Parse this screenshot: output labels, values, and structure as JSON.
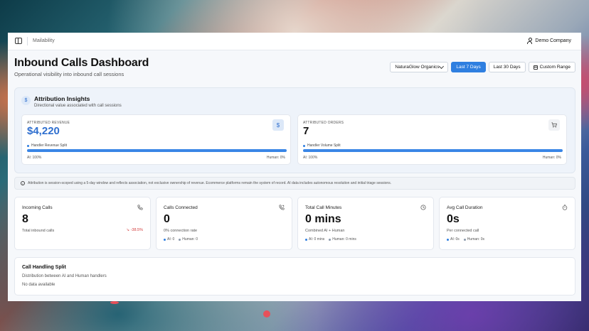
{
  "topbar": {
    "breadcrumb": "Mailability",
    "company": "Demo Company"
  },
  "header": {
    "title": "Inbound Calls Dashboard",
    "subtitle": "Operational visibility into inbound call sessions"
  },
  "controls": {
    "store_select": "NaturaGlow Organics",
    "last7": "Last 7 Days",
    "last30": "Last 30 Days",
    "custom": "Custom Range",
    "active_color": "#2f7fe0"
  },
  "attribution": {
    "icon": "$",
    "title": "Attribution Insights",
    "subtitle": "Directional value associated with call sessions",
    "revenue": {
      "label": "ATTRIBUTED REVENUE",
      "value": "$4,220",
      "split_label": "Handler Revenue Split",
      "ai": "AI: 100%",
      "human": "Human: 0%",
      "ai_fraction": 1.0,
      "color": "#2f7fe0"
    },
    "orders": {
      "label": "ATTRIBUTED ORDERS",
      "value": "7",
      "split_label": "Handler Volume Split",
      "ai": "AI: 100%",
      "human": "Human: 0%",
      "ai_fraction": 1.0,
      "color": "#111111"
    }
  },
  "note": "Attribution is session-scoped using a 5-day window and reflects association, not exclusive ownership of revenue. Ecommerce platforms remain the system of record. AI data includes autonomous resolution and initial triage sessions.",
  "kpis": {
    "incoming": {
      "label": "Incoming Calls",
      "value": "8",
      "sub": "Total inbound calls",
      "trend": "-38.5%"
    },
    "connected": {
      "label": "Calls Connected",
      "value": "0",
      "sub": "0% connection rate",
      "ai": "AI: 0",
      "human": "Human: 0"
    },
    "minutes": {
      "label": "Total Call Minutes",
      "value": "0 mins",
      "sub": "Combined AI + Human",
      "ai": "AI: 0 mins",
      "human": "Human: 0 mins"
    },
    "duration": {
      "label": "Avg Call Duration",
      "value": "0s",
      "sub": "Per connected call",
      "ai": "AI: 0s",
      "human": "Human: 0s"
    }
  },
  "handling_split": {
    "title": "Call Handling Split",
    "subtitle": "Distribution between AI and Human handlers",
    "empty": "No data available"
  }
}
